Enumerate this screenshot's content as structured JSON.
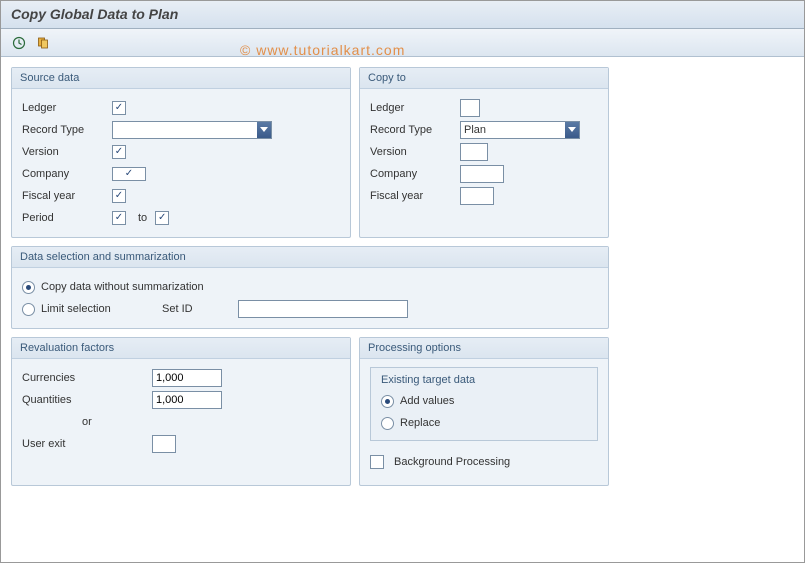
{
  "titlebar": {
    "title": "Copy Global Data to Plan"
  },
  "toolbar": {
    "execute_icon": "execute-icon",
    "copy_icon": "copy-icon"
  },
  "watermark": "© www.tutorialkart.com",
  "source": {
    "title": "Source data",
    "ledger_label": "Ledger",
    "record_type_label": "Record Type",
    "version_label": "Version",
    "company_label": "Company",
    "fiscal_year_label": "Fiscal year",
    "period_label": "Period",
    "to_label": "to",
    "record_type_value": ""
  },
  "copy_to": {
    "title": "Copy to",
    "ledger_label": "Ledger",
    "record_type_label": "Record Type",
    "record_type_value": "Plan",
    "version_label": "Version",
    "company_label": "Company",
    "fiscal_year_label": "Fiscal year"
  },
  "data_sel": {
    "title": "Data selection and summarization",
    "opt1": "Copy data without summarization",
    "opt2": "Limit selection",
    "setid_label": "Set ID",
    "setid_value": ""
  },
  "reval": {
    "title": "Revaluation factors",
    "currencies_label": "Currencies",
    "currencies_value": "1,000",
    "quantities_label": "Quantities",
    "quantities_value": "1,000",
    "or_label": "or",
    "user_exit_label": "User exit",
    "user_exit_value": ""
  },
  "proc": {
    "title": "Processing options",
    "existing_title": "Existing target data",
    "add_label": "Add values",
    "replace_label": "Replace",
    "bg_label": "Background Processing"
  }
}
